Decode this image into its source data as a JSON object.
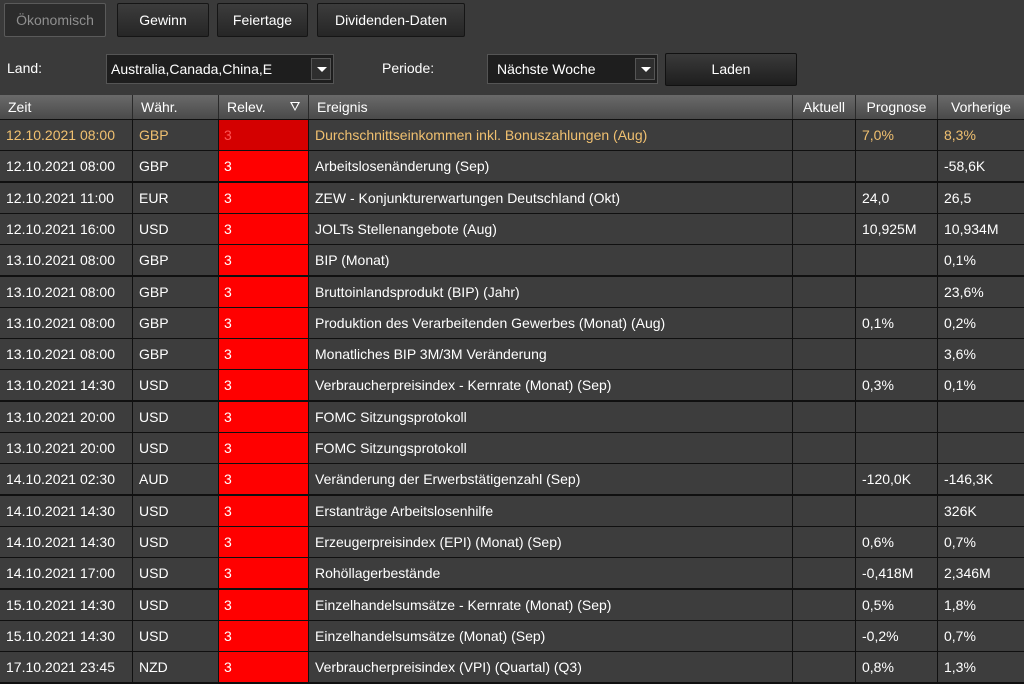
{
  "tabs": [
    {
      "label": "Ökonomisch",
      "disabled": true
    },
    {
      "label": "Gewinn",
      "disabled": false
    },
    {
      "label": "Feiertage",
      "disabled": false
    },
    {
      "label": "Dividenden-Daten",
      "disabled": false
    }
  ],
  "filters": {
    "country_label": "Land:",
    "country_value": "Australia,Canada,China,E",
    "period_label": "Periode:",
    "period_value": "Nächste Woche",
    "load_label": "Laden"
  },
  "columns": [
    "Zeit",
    "Währ.",
    "Relev.",
    "Ereignis",
    "Aktuell",
    "Prognose",
    "Vorherige"
  ],
  "rows": [
    {
      "zeit": "12.10.2021 08:00",
      "waehr": "GBP",
      "relev": "3",
      "ereignis": "Durchschnittseinkommen inkl. Bonuszahlungen  (Aug)",
      "aktuell": "",
      "prognose": "7,0%",
      "vorherige": "8,3%",
      "highlight": true
    },
    {
      "zeit": "12.10.2021 08:00",
      "waehr": "GBP",
      "relev": "3",
      "ereignis": "Arbeitslosenänderung  (Sep)",
      "aktuell": "",
      "prognose": "",
      "vorherige": "-58,6K"
    },
    {
      "zeit": "12.10.2021 11:00",
      "waehr": "EUR",
      "relev": "3",
      "ereignis": "ZEW - Konjunkturerwartungen Deutschland  (Okt)",
      "aktuell": "",
      "prognose": "24,0",
      "vorherige": "26,5"
    },
    {
      "zeit": "12.10.2021 16:00",
      "waehr": "USD",
      "relev": "3",
      "ereignis": "JOLTs Stellenangebote  (Aug)",
      "aktuell": "",
      "prognose": "10,925M",
      "vorherige": "10,934M"
    },
    {
      "zeit": "13.10.2021 08:00",
      "waehr": "GBP",
      "relev": "3",
      "ereignis": "BIP (Monat)",
      "aktuell": "",
      "prognose": "",
      "vorherige": "0,1%"
    },
    {
      "zeit": "13.10.2021 08:00",
      "waehr": "GBP",
      "relev": "3",
      "ereignis": "Bruttoinlandsprodukt (BIP) (Jahr)",
      "aktuell": "",
      "prognose": "",
      "vorherige": "23,6%"
    },
    {
      "zeit": "13.10.2021 08:00",
      "waehr": "GBP",
      "relev": "3",
      "ereignis": "Produktion des Verarbeitenden Gewerbes (Monat)  (Aug)",
      "aktuell": "",
      "prognose": "0,1%",
      "vorherige": "0,2%"
    },
    {
      "zeit": "13.10.2021 08:00",
      "waehr": "GBP",
      "relev": "3",
      "ereignis": "Monatliches BIP 3M/3M Veränderung",
      "aktuell": "",
      "prognose": "",
      "vorherige": "3,6%"
    },
    {
      "zeit": "13.10.2021 14:30",
      "waehr": "USD",
      "relev": "3",
      "ereignis": "Verbraucherpreisindex - Kernrate (Monat)  (Sep)",
      "aktuell": "",
      "prognose": "0,3%",
      "vorherige": "0,1%"
    },
    {
      "zeit": "13.10.2021 20:00",
      "waehr": "USD",
      "relev": "3",
      "ereignis": "FOMC Sitzungsprotokoll",
      "aktuell": "",
      "prognose": "",
      "vorherige": ""
    },
    {
      "zeit": "13.10.2021 20:00",
      "waehr": "USD",
      "relev": "3",
      "ereignis": "FOMC Sitzungsprotokoll",
      "aktuell": "",
      "prognose": "",
      "vorherige": ""
    },
    {
      "zeit": "14.10.2021 02:30",
      "waehr": "AUD",
      "relev": "3",
      "ereignis": "Veränderung der Erwerbstätigenzahl  (Sep)",
      "aktuell": "",
      "prognose": "-120,0K",
      "vorherige": "-146,3K"
    },
    {
      "zeit": "14.10.2021 14:30",
      "waehr": "USD",
      "relev": "3",
      "ereignis": "Erstanträge Arbeitslosenhilfe",
      "aktuell": "",
      "prognose": "",
      "vorherige": "326K"
    },
    {
      "zeit": "14.10.2021 14:30",
      "waehr": "USD",
      "relev": "3",
      "ereignis": "Erzeugerpreisindex (EPI) (Monat)  (Sep)",
      "aktuell": "",
      "prognose": "0,6%",
      "vorherige": "0,7%"
    },
    {
      "zeit": "14.10.2021 17:00",
      "waehr": "USD",
      "relev": "3",
      "ereignis": "Rohöllagerbestände",
      "aktuell": "",
      "prognose": "-0,418M",
      "vorherige": "2,346M"
    },
    {
      "zeit": "15.10.2021 14:30",
      "waehr": "USD",
      "relev": "3",
      "ereignis": "Einzelhandelsumsätze - Kernrate (Monat)  (Sep)",
      "aktuell": "",
      "prognose": "0,5%",
      "vorherige": "1,8%"
    },
    {
      "zeit": "15.10.2021 14:30",
      "waehr": "USD",
      "relev": "3",
      "ereignis": "Einzelhandelsumsätze (Monat)  (Sep)",
      "aktuell": "",
      "prognose": "-0,2%",
      "vorherige": "0,7%"
    },
    {
      "zeit": "17.10.2021 23:45",
      "waehr": "NZD",
      "relev": "3",
      "ereignis": "Verbraucherpreisindex (VPI) (Quartal)  (Q3)",
      "aktuell": "",
      "prognose": "0,8%",
      "vorherige": "1,3%"
    }
  ],
  "colors": {
    "relevance_high": "#ff0000",
    "highlight_text": "#f0c070"
  }
}
